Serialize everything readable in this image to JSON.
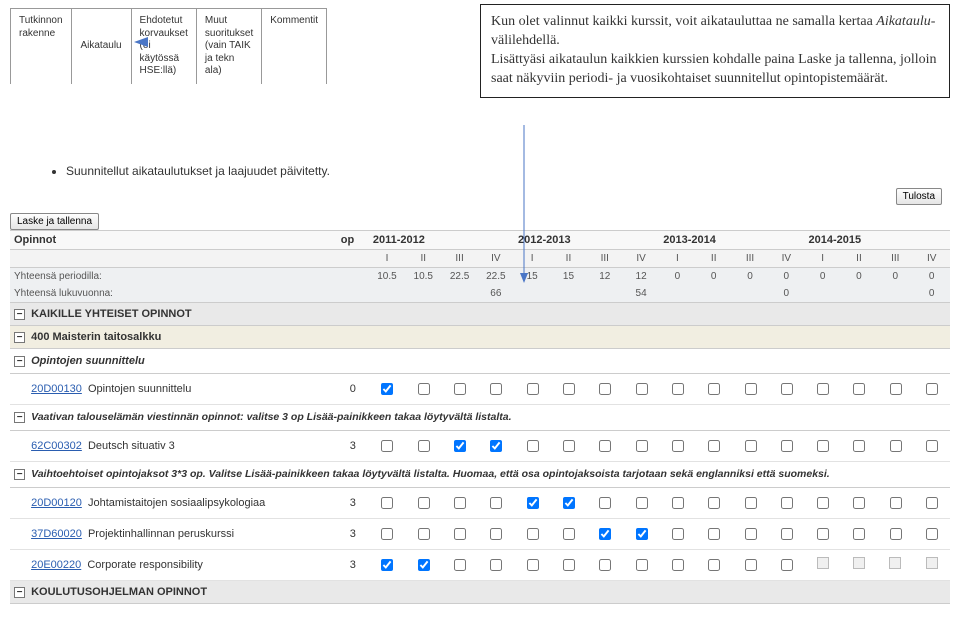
{
  "tabs": {
    "t1": "Tutkinnon\nrakenne",
    "t2": "Aikataulu",
    "t3": "Ehdotetut\nkorvaukset\n(ei\nkäytössä\nHSE:llä)",
    "t4": "Muut\nsuoritukset\n(vain TAIK\nja tekn\nala)",
    "t5": "Kommentit"
  },
  "infobox": {
    "p1a": "Kun olet valinnut kaikki kurssit, voit aikatauluttaa ne samalla kertaa ",
    "p1b": "Aikataulu",
    "p1c": "-välilehdellä.",
    "p2": "Lisättyäsi aikataulun kaikkien kurssien kohdalle paina Laske ja tallenna, jolloin saat näkyviin periodi- ja vuosikohtaiset suunnitellut opintopistemäärät."
  },
  "status": "Suunnitellut aikataulutukset ja laajuudet päivitetty.",
  "buttons": {
    "print": "Tulosta",
    "calc": "Laske ja tallenna"
  },
  "headers": {
    "opinnot": "Opinnot",
    "op": "op",
    "years": [
      "2011-2012",
      "2012-2013",
      "2013-2014",
      "2014-2015"
    ],
    "periods": [
      "I",
      "II",
      "III",
      "IV"
    ]
  },
  "totals": {
    "period_label": "Yhteensä periodilla:",
    "year_label": "Yhteensä lukuvuonna:",
    "periods": [
      "10.5",
      "10.5",
      "22.5",
      "22.5",
      "15",
      "15",
      "12",
      "12",
      "0",
      "0",
      "0",
      "0",
      "0",
      "0",
      "0",
      "0"
    ],
    "years": [
      "66",
      "54",
      "0",
      "0"
    ]
  },
  "sections": {
    "all": "KAIKILLE YHTEISET OPINNOT",
    "masters": "400 Maisterin taitosalkku",
    "planning": "Opintojen suunnittelu",
    "program": "KOULUTUSOHJELMAN OPINNOT"
  },
  "notes": {
    "n1": "Vaativan talouselämän viestinnän opinnot: valitse 3 op Lisää-painikkeen takaa löytyvältä listalta.",
    "n2": "Vaihtoehtoiset opintojaksot 3*3 op. Valitse Lisää-painikkeen takaa löytyvältä listalta. Huomaa, että osa opintojaksoista tarjotaan sekä englanniksi että suomeksi."
  },
  "courses": [
    {
      "code": "20D00130",
      "name": "Opintojen suunnittelu",
      "op": "0",
      "checks": [
        true,
        false,
        false,
        false,
        false,
        false,
        false,
        false,
        false,
        false,
        false,
        false,
        false,
        false,
        false,
        false
      ]
    },
    {
      "code": "62C00302",
      "name": "Deutsch situativ 3",
      "op": "3",
      "checks": [
        false,
        false,
        true,
        true,
        false,
        false,
        false,
        false,
        false,
        false,
        false,
        false,
        false,
        false,
        false,
        false
      ]
    },
    {
      "code": "20D00120",
      "name": "Johtamistaitojen sosiaalipsykologiaa",
      "op": "3",
      "checks": [
        false,
        false,
        false,
        false,
        true,
        true,
        false,
        false,
        false,
        false,
        false,
        false,
        false,
        false,
        false,
        false
      ]
    },
    {
      "code": "37D60020",
      "name": "Projektinhallinnan peruskurssi",
      "op": "3",
      "checks": [
        false,
        false,
        false,
        false,
        false,
        false,
        true,
        true,
        false,
        false,
        false,
        false,
        false,
        false,
        false,
        false
      ]
    },
    {
      "code": "20E00220",
      "name": "Corporate responsibility",
      "op": "3",
      "checks": [
        true,
        true,
        false,
        false,
        false,
        false,
        false,
        false,
        false,
        false,
        false,
        false,
        false,
        false,
        false,
        false
      ]
    }
  ],
  "minus": "−"
}
